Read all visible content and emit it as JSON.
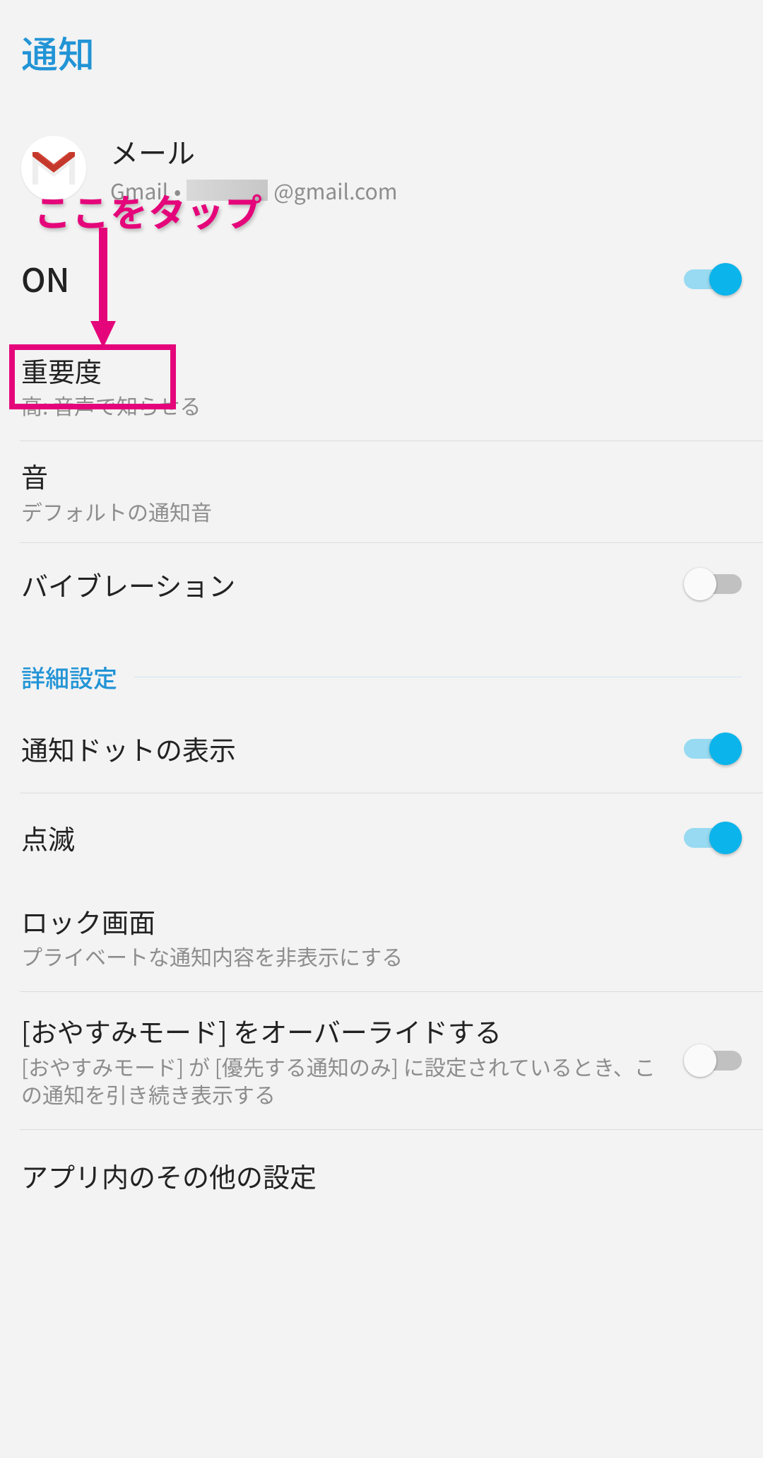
{
  "page_title": "通知",
  "app": {
    "name": "メール",
    "account_prefix": "Gmail",
    "account_separator": " • ",
    "account_suffix": "@gmail.com"
  },
  "rows": {
    "on": {
      "title": "ON",
      "state": "on"
    },
    "importance": {
      "title": "重要度",
      "sub": "高: 音声で知らせる"
    },
    "sound": {
      "title": "音",
      "sub": "デフォルトの通知音"
    },
    "vibration": {
      "title": "バイブレーション",
      "state": "off"
    },
    "dot": {
      "title": "通知ドットの表示",
      "state": "on"
    },
    "blink": {
      "title": "点滅",
      "state": "on"
    },
    "lock": {
      "title": "ロック画面",
      "sub": "プライベートな通知内容を非表示にする"
    },
    "dnd": {
      "title": "[おやすみモード] をオーバーライドする",
      "sub": "[おやすみモード] が [優先する通知のみ] に設定されているとき、この通知を引き続き表示する",
      "state": "off"
    },
    "in_app": {
      "title": "アプリ内のその他の設定"
    }
  },
  "section_header": "詳細設定",
  "annotation_text": "ここをタップ",
  "colors": {
    "accent": "#2294d6",
    "switch_on_track": "#97daf1",
    "switch_on_knob": "#0bb4eb",
    "annotation": "#e5057a"
  }
}
